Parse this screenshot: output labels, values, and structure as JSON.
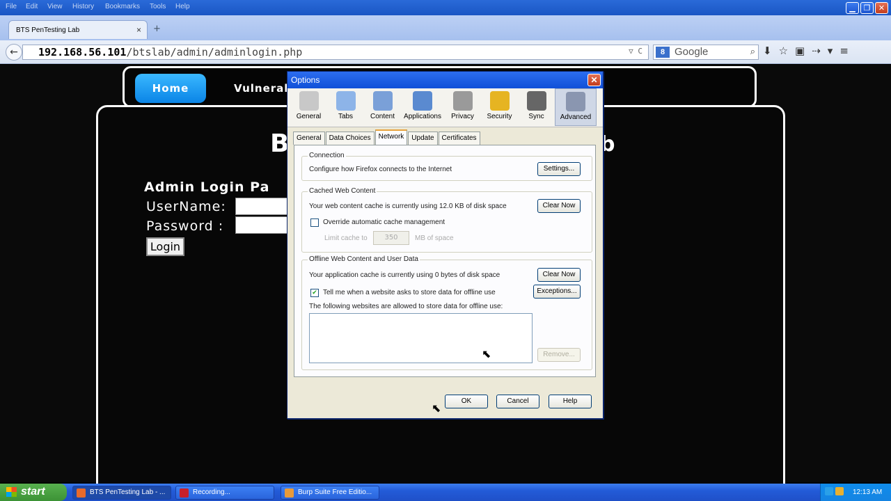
{
  "window": {
    "menus": [
      "File",
      "Edit",
      "View",
      "History",
      "Bookmarks",
      "Tools",
      "Help"
    ],
    "controls": {
      "minimize": "▁",
      "restore": "❐",
      "close": "✕"
    }
  },
  "tabs": {
    "active_title": "BTS PenTesting Lab",
    "close": "×",
    "new_tab": "+"
  },
  "nav": {
    "back": "←",
    "url_host": "192.168.56.101",
    "url_path": "/btslab/admin/adminlogin.php",
    "url_icons": "▽ C",
    "search_engine": "8",
    "search_placeholder": "Google",
    "search_icon": "⌕",
    "toolbar_icons": [
      "⬇",
      "☆",
      "▣",
      "⇢",
      "▾",
      "≡"
    ]
  },
  "site": {
    "nav_home": "Home",
    "nav_vuln": "Vulnerab",
    "title_left": "B",
    "title_right": "b",
    "login_heading": "Admin Login Pa",
    "username_label": "UserName:",
    "password_label": "Password :",
    "login_button": "Login"
  },
  "dialog": {
    "title": "Options",
    "close": "✕",
    "panes": [
      {
        "label": "General",
        "icon": "general-icon",
        "color": "#c8c8c8"
      },
      {
        "label": "Tabs",
        "icon": "tabs-icon",
        "color": "#8db4e8"
      },
      {
        "label": "Content",
        "icon": "content-icon",
        "color": "#7aa0d8"
      },
      {
        "label": "Applications",
        "icon": "applications-icon",
        "color": "#5a8ad0"
      },
      {
        "label": "Privacy",
        "icon": "privacy-icon",
        "color": "#9a9a9a"
      },
      {
        "label": "Security",
        "icon": "security-icon",
        "color": "#e6b422"
      },
      {
        "label": "Sync",
        "icon": "sync-icon",
        "color": "#666666"
      },
      {
        "label": "Advanced",
        "icon": "advanced-icon",
        "color": "#8a96b0"
      }
    ],
    "selected_pane": "Advanced",
    "subtabs": [
      "General",
      "Data Choices",
      "Network",
      "Update",
      "Certificates"
    ],
    "selected_subtab": "Network",
    "connection": {
      "label": "Connection",
      "text": "Configure how Firefox connects to the Internet",
      "button": "Settings..."
    },
    "cache": {
      "label": "Cached Web Content",
      "text": "Your web content cache is currently using 12.0 KB of disk space",
      "button": "Clear Now",
      "override_label": "Override automatic cache management",
      "override_checked": false,
      "limit_label": "Limit cache to",
      "limit_value": "350",
      "limit_unit": "MB of space"
    },
    "offline": {
      "label": "Offline Web Content and User Data",
      "text": "Your application cache is currently using 0 bytes of disk space",
      "button": "Clear Now",
      "tell_label": "Tell me when a website asks to store data for offline use",
      "tell_checked": true,
      "exceptions_button": "Exceptions...",
      "allowed_label": "The following websites are allowed to store data for offline use:",
      "remove_button": "Remove..."
    },
    "buttons": {
      "ok": "OK",
      "cancel": "Cancel",
      "help": "Help"
    }
  },
  "taskbar": {
    "start": "start",
    "items": [
      {
        "label": "BTS PenTesting Lab - ...",
        "color": "#e86a2a"
      },
      {
        "label": "Recording...",
        "color": "#c8202a"
      },
      {
        "label": "Burp Suite Free Editio...",
        "color": "#e89a3a"
      }
    ],
    "clock": "12:13 AM"
  }
}
